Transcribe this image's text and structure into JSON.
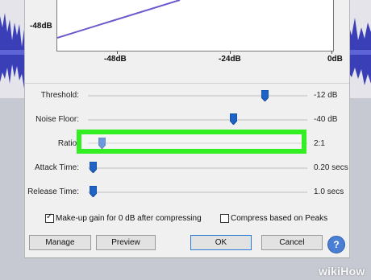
{
  "graph": {
    "y_label": "-48dB",
    "x_labels": [
      "-48dB",
      "-24dB",
      "0dB"
    ]
  },
  "controls": [
    {
      "label": "Threshold:",
      "value": "-12 dB",
      "level": 0.81
    },
    {
      "label": "Noise Floor:",
      "value": "-40 dB",
      "level": 0.66
    },
    {
      "label": "Ratio:",
      "value": "2:1",
      "level": 0.04
    },
    {
      "label": "Attack Time:",
      "value": "0.20 secs",
      "level": 0.0
    },
    {
      "label": "Release Time:",
      "value": "1.0 secs",
      "level": 0.0
    }
  ],
  "checkboxes": [
    {
      "label": "Make-up gain for 0 dB after compressing",
      "checked": true
    },
    {
      "label": "Compress based on Peaks",
      "checked": false
    }
  ],
  "buttons": {
    "manage": "Manage",
    "preview": "Preview",
    "ok": "OK",
    "cancel": "Cancel",
    "help": "?"
  },
  "colors": {
    "accent": "#2c7ad6",
    "highlight": "#33ee22",
    "curve": "#6a5acd",
    "waveform": "#3a3fb8"
  },
  "watermark": "wikiHow"
}
